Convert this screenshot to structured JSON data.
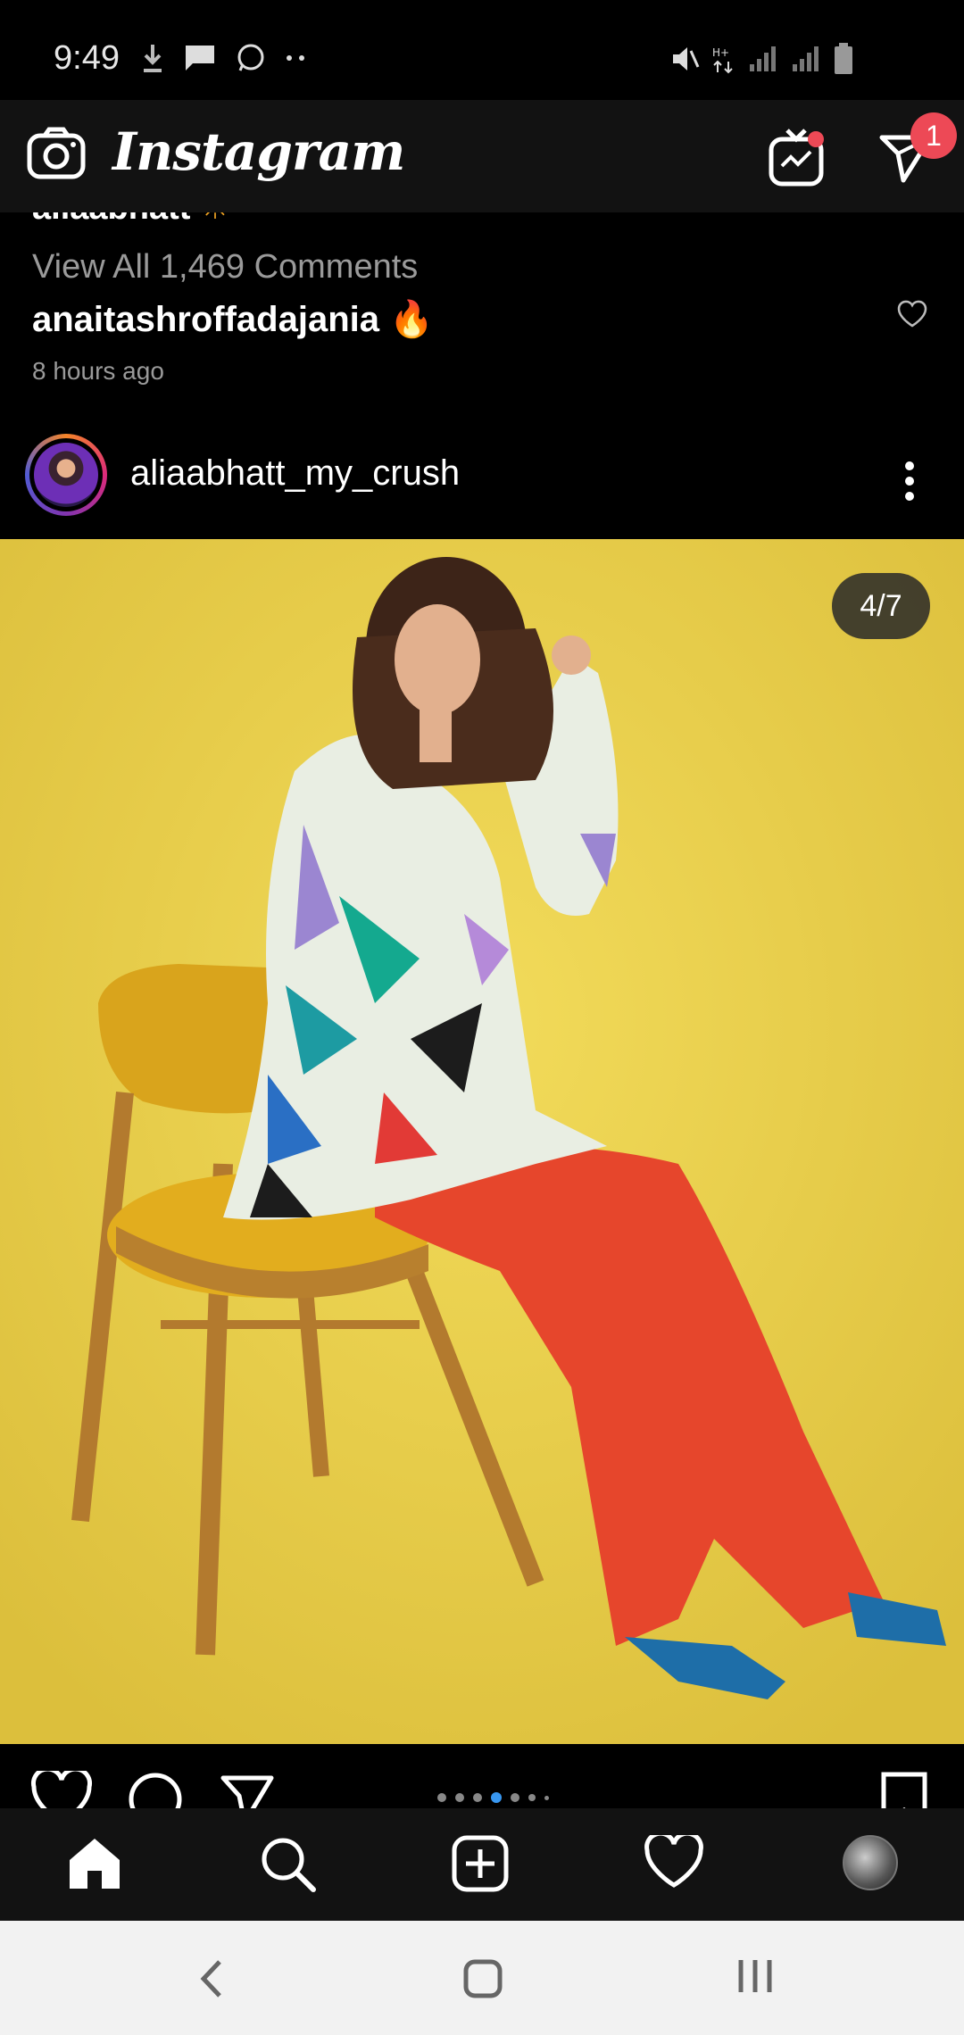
{
  "status_bar": {
    "time": "9:49",
    "left_icons": [
      "download-icon",
      "message-icon",
      "whatsapp-icon",
      "more-dots-icon"
    ],
    "right_icons": [
      "mute-icon",
      "data-icon",
      "signal-icon",
      "signal-icon",
      "battery-icon"
    ]
  },
  "app_bar": {
    "logo": "Instagram",
    "dm_badge": "1"
  },
  "previous_post": {
    "cut_username": "aliaabhatt",
    "view_all": "View All 1,469 Comments",
    "comment_user": "anaitashroffadajania",
    "comment_emoji": "🔥",
    "time_ago": "8 hours ago"
  },
  "post": {
    "username": "aliaabhatt_my_crush",
    "carousel_position": "4/7",
    "carousel_index": 4,
    "carousel_total": 7
  },
  "colors": {
    "background": "#000000",
    "bar": "#121212",
    "badge": "#ed4956",
    "dot_active": "#3897f0",
    "photo_bg": "#ebd04a"
  },
  "bottom_nav": [
    "home-icon",
    "search-icon",
    "add-post-icon",
    "activity-heart-icon",
    "profile-avatar"
  ]
}
